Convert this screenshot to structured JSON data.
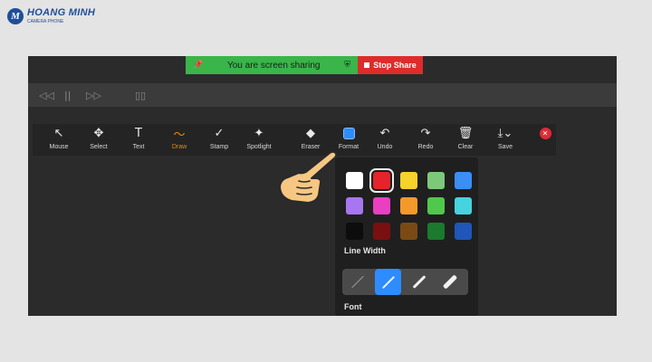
{
  "logo": {
    "mark": "M",
    "name": "HOANG MINH",
    "sub": "CAMERA PHONE"
  },
  "banner": {
    "sharing_text": "You are screen sharing",
    "stop_label": "Stop Share",
    "green": "#39b54a",
    "red": "#de2b2b"
  },
  "mid_controls": [
    "◁◁",
    "||",
    "▷▷",
    "▯▯"
  ],
  "toolbar": {
    "tools": [
      {
        "label": "Mouse",
        "icon": "mouse-pointer-icon",
        "glyph": "↖"
      },
      {
        "label": "Select",
        "icon": "move-icon",
        "glyph": "✥"
      },
      {
        "label": "Text",
        "icon": "text-icon",
        "glyph": "T"
      },
      {
        "label": "Draw",
        "icon": "draw-icon",
        "glyph": "〜",
        "active": true
      },
      {
        "label": "Stamp",
        "icon": "stamp-icon",
        "glyph": "✓"
      },
      {
        "label": "Spotlight",
        "icon": "spotlight-icon",
        "glyph": "✦"
      },
      {
        "label": "Eraser",
        "icon": "eraser-icon",
        "glyph": "◆"
      },
      {
        "label": "Format",
        "icon": "format-icon",
        "glyph": ""
      },
      {
        "label": "Undo",
        "icon": "undo-icon",
        "glyph": "↶"
      },
      {
        "label": "Redo",
        "icon": "redo-icon",
        "glyph": "↷"
      },
      {
        "label": "Clear",
        "icon": "trash-icon",
        "glyph": "🗑"
      },
      {
        "label": "Save",
        "icon": "save-icon",
        "glyph": "⤓⌄"
      }
    ],
    "active_color": "#e78a16"
  },
  "format_panel": {
    "colors": [
      "#ffffff",
      "#e5232a",
      "#f5d32a",
      "#7cc97a",
      "#3a8ef6",
      "#a776f0",
      "#ea3fc0",
      "#f59a2a",
      "#4fc84c",
      "#45d3de",
      "#0d0d0d",
      "#7a0f12",
      "#7a4a15",
      "#1a7a2e",
      "#1f56b8"
    ],
    "selected_color": "#e5232a",
    "line_width_label": "Line Width",
    "font_label": "Font",
    "line_widths": [
      "thin",
      "light",
      "medium",
      "thick"
    ],
    "selected_width": "light"
  }
}
